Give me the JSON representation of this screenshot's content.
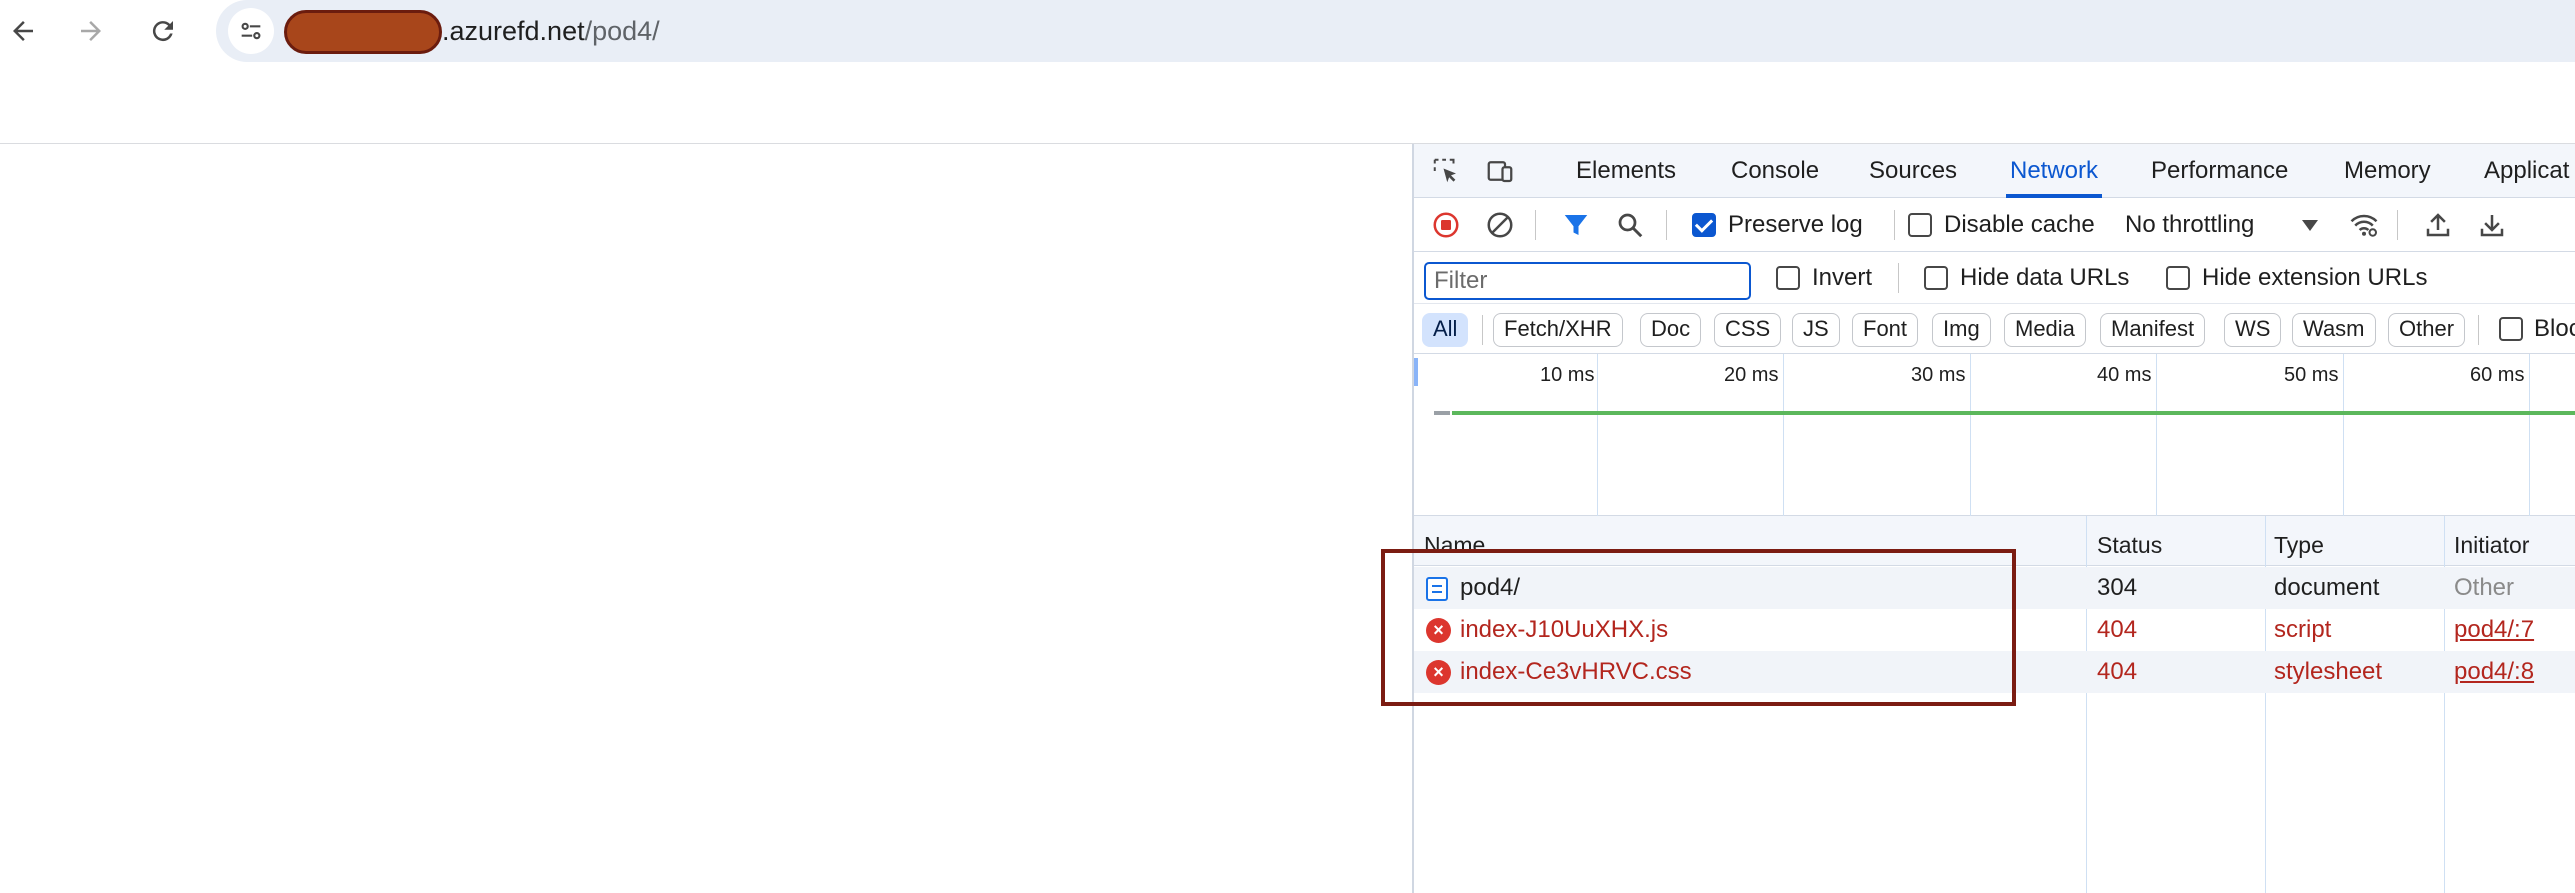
{
  "browser": {
    "url_host": ".azurefd.net",
    "url_path": "/pod4/",
    "icons": [
      "back-icon",
      "forward-icon",
      "reload-icon",
      "site-info-icon"
    ]
  },
  "devtools": {
    "tabs": [
      "Elements",
      "Console",
      "Sources",
      "Network",
      "Performance",
      "Memory",
      "Applicat"
    ],
    "active_tab": "Network",
    "toolbar": {
      "preserve_log": "Preserve log",
      "preserve_log_checked": true,
      "disable_cache": "Disable cache",
      "throttling": "No throttling"
    },
    "filter": {
      "placeholder": "Filter",
      "invert": "Invert",
      "hide_data_urls": "Hide data URLs",
      "hide_extension_urls": "Hide extension URLs"
    },
    "type_filters": [
      "All",
      "Fetch/XHR",
      "Doc",
      "CSS",
      "JS",
      "Font",
      "Img",
      "Media",
      "Manifest",
      "WS",
      "Wasm",
      "Other",
      "Bloc"
    ],
    "active_type": "All",
    "timeline_ticks": [
      "10 ms",
      "20 ms",
      "30 ms",
      "40 ms",
      "50 ms",
      "60 ms"
    ],
    "table": {
      "columns": [
        "Name",
        "Status",
        "Type",
        "Initiator"
      ],
      "rows": [
        {
          "name": "pod4/",
          "status": "304",
          "type": "document",
          "initiator": "Other",
          "error": false
        },
        {
          "name": "index-J10UuXHX.js",
          "status": "404",
          "type": "script",
          "initiator": "pod4/:7",
          "error": true
        },
        {
          "name": "index-Ce3vHRVC.css",
          "status": "404",
          "type": "stylesheet",
          "initiator": "pod4/:8",
          "error": true
        }
      ]
    },
    "colors": {
      "accent": "#0b57d0",
      "error": "#b3261e",
      "highlight_box": "#7b1c12",
      "redaction": "#a8461b"
    }
  }
}
